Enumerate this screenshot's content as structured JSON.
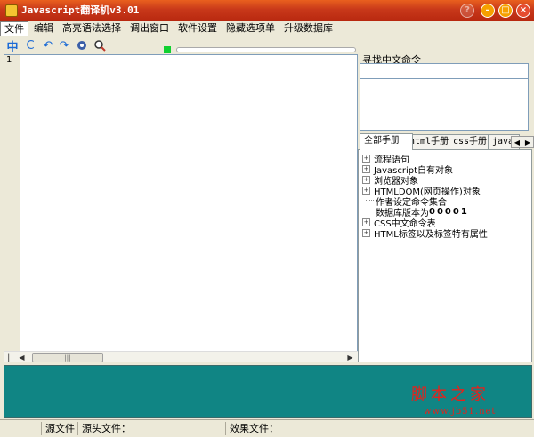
{
  "window": {
    "title": "Javascript翻译机v3.01"
  },
  "menu": [
    "文件",
    "编辑",
    "高亮语法选择",
    "调出窗口",
    "软件设置",
    "隐藏选项单",
    "升级数据库"
  ],
  "toolbar": {
    "chinese_label": "中",
    "refresh_glyph": "C"
  },
  "editor": {
    "line_number": "1"
  },
  "search": {
    "label": "寻找中文命令",
    "value": ""
  },
  "tabs": [
    "全部手册",
    "html手册",
    "css手册",
    "java"
  ],
  "tree": [
    {
      "label": "流程语句",
      "expandable": true
    },
    {
      "label": "Javascript自有对象",
      "expandable": true
    },
    {
      "label": "浏览器对象",
      "expandable": true
    },
    {
      "label": "HTMLDOM(网页操作)对象",
      "expandable": true
    },
    {
      "label": "作者设定命令集合",
      "expandable": false
    },
    {
      "label_prefix": "数据库版本为",
      "label_suffix": "00001",
      "expandable": false
    },
    {
      "label": "CSS中文命令表",
      "expandable": true
    },
    {
      "label": "HTML标签以及标签特有属性",
      "expandable": true
    }
  ],
  "watermark": {
    "text": "脚本之家",
    "url": "www.jb51.net"
  },
  "status": {
    "source_file": "源文件",
    "source_header": "源头文件：",
    "effect_file": "效果文件："
  },
  "colors": {
    "title_bar": "#c8381a",
    "output_panel": "#108584",
    "watermark": "#e8201a"
  }
}
